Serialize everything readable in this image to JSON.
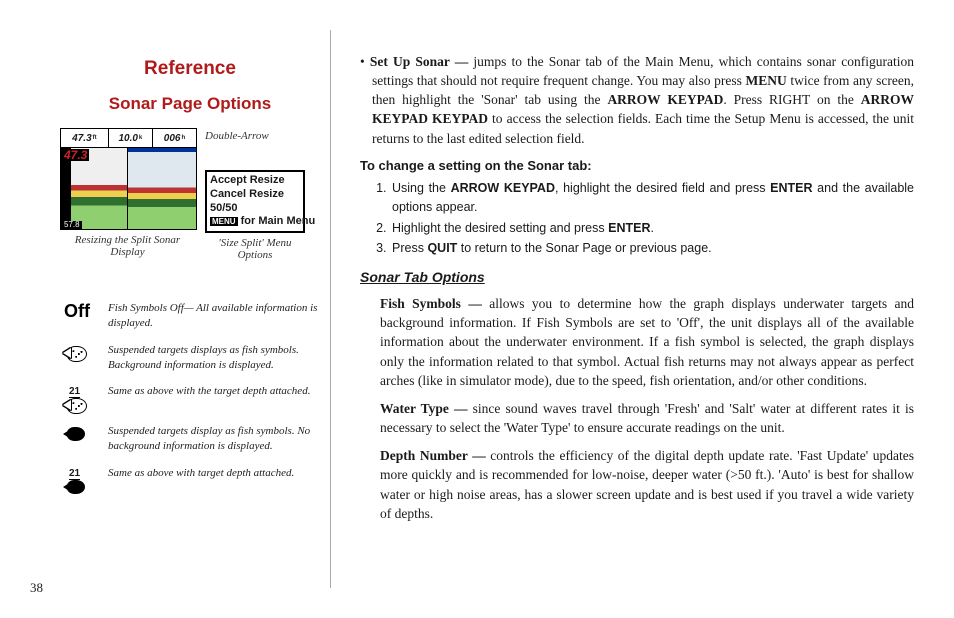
{
  "left": {
    "heading": "Reference",
    "subheading": "Sonar Page Options",
    "fig1": {
      "top_vals": [
        "47.3",
        "10.0",
        "006"
      ],
      "top_units": [
        "ft",
        "k",
        "h"
      ],
      "depth_overlay": "47.3",
      "bottom_left": "57.8",
      "caption": "Resizing the Split Sonar Display",
      "arrow_label": "Double-Arrow"
    },
    "fig2": {
      "lines": [
        "Accept Resize",
        "Cancel Resize",
        "50/50"
      ],
      "menu_key": "MENU",
      "menu_tail": " for Main Menu",
      "caption": "'Size Split' Menu Options"
    },
    "symbols": [
      {
        "icon": "off",
        "text": "Fish Symbols Off— All available information is displayed."
      },
      {
        "icon": "fish-dotted",
        "text": "Suspended targets displays as fish symbols. Background information is displayed."
      },
      {
        "icon": "fish-dotted-d",
        "depth": "21",
        "text": "Same as above with the target depth attached."
      },
      {
        "icon": "fish-solid",
        "text": "Suspended targets display as fish symbols. No background information is displayed."
      },
      {
        "icon": "fish-solid-d",
        "depth": "21",
        "text": "Same as above with target depth attached."
      }
    ]
  },
  "right": {
    "setup_sonar_lead": "Set Up Sonar —",
    "setup_sonar_text_1": " jumps to the Sonar tab of the Main Menu, which contains sonar configuration settings that should not require frequent change. You may also press ",
    "kw_menu": "MENU",
    "setup_sonar_text_2": " twice from any screen, then highlight the 'Sonar' tab using the ",
    "kw_arrowkp": "ARROW KEYPAD",
    "setup_sonar_text_3": ". Press RIGHT on the ",
    "setup_sonar_text_4": " to access the selection fields. Each time the Setup Menu is accessed, the unit returns to the last edited selection field.",
    "steps_heading": "To change a setting on the Sonar tab:",
    "steps": {
      "s1a": "Using the ",
      "s1b": ", highlight the desired field and press ",
      "s1c": " and the available options appear.",
      "s2a": "Highlight the desired setting and press ",
      "s2b": ".",
      "s3a": "Press ",
      "s3b": " to return to the Sonar Page or previous page."
    },
    "kw_enter": "ENTER",
    "kw_quit": "QUIT",
    "section_heading": "Sonar Tab Options",
    "fish_lead": "Fish Symbols —",
    "fish_text": " allows you to determine how the graph displays underwater targets and background information. If Fish Symbols are set to 'Off', the unit displays all of the available information about the underwater environment. If a fish symbol is selected, the graph displays only the information related to that symbol. Actual fish returns may not always appear as perfect arches (like in simulator mode), due to the speed, fish orientation, and/or other conditions.",
    "water_lead": "Water Type —",
    "water_text": " since sound waves travel through 'Fresh' and 'Salt' water at different rates it is necessary to select the 'Water Type' to ensure accurate readings on the unit.",
    "depth_lead": "Depth Number —",
    "depth_text": " controls the efficiency of the digital depth update rate. 'Fast Update' updates more quickly and is recommended for low-noise, deeper water (>50 ft.). 'Auto' is best for shallow water or high noise areas, has a slower screen update and is best used if you travel a wide variety of depths."
  },
  "page_number": "38"
}
